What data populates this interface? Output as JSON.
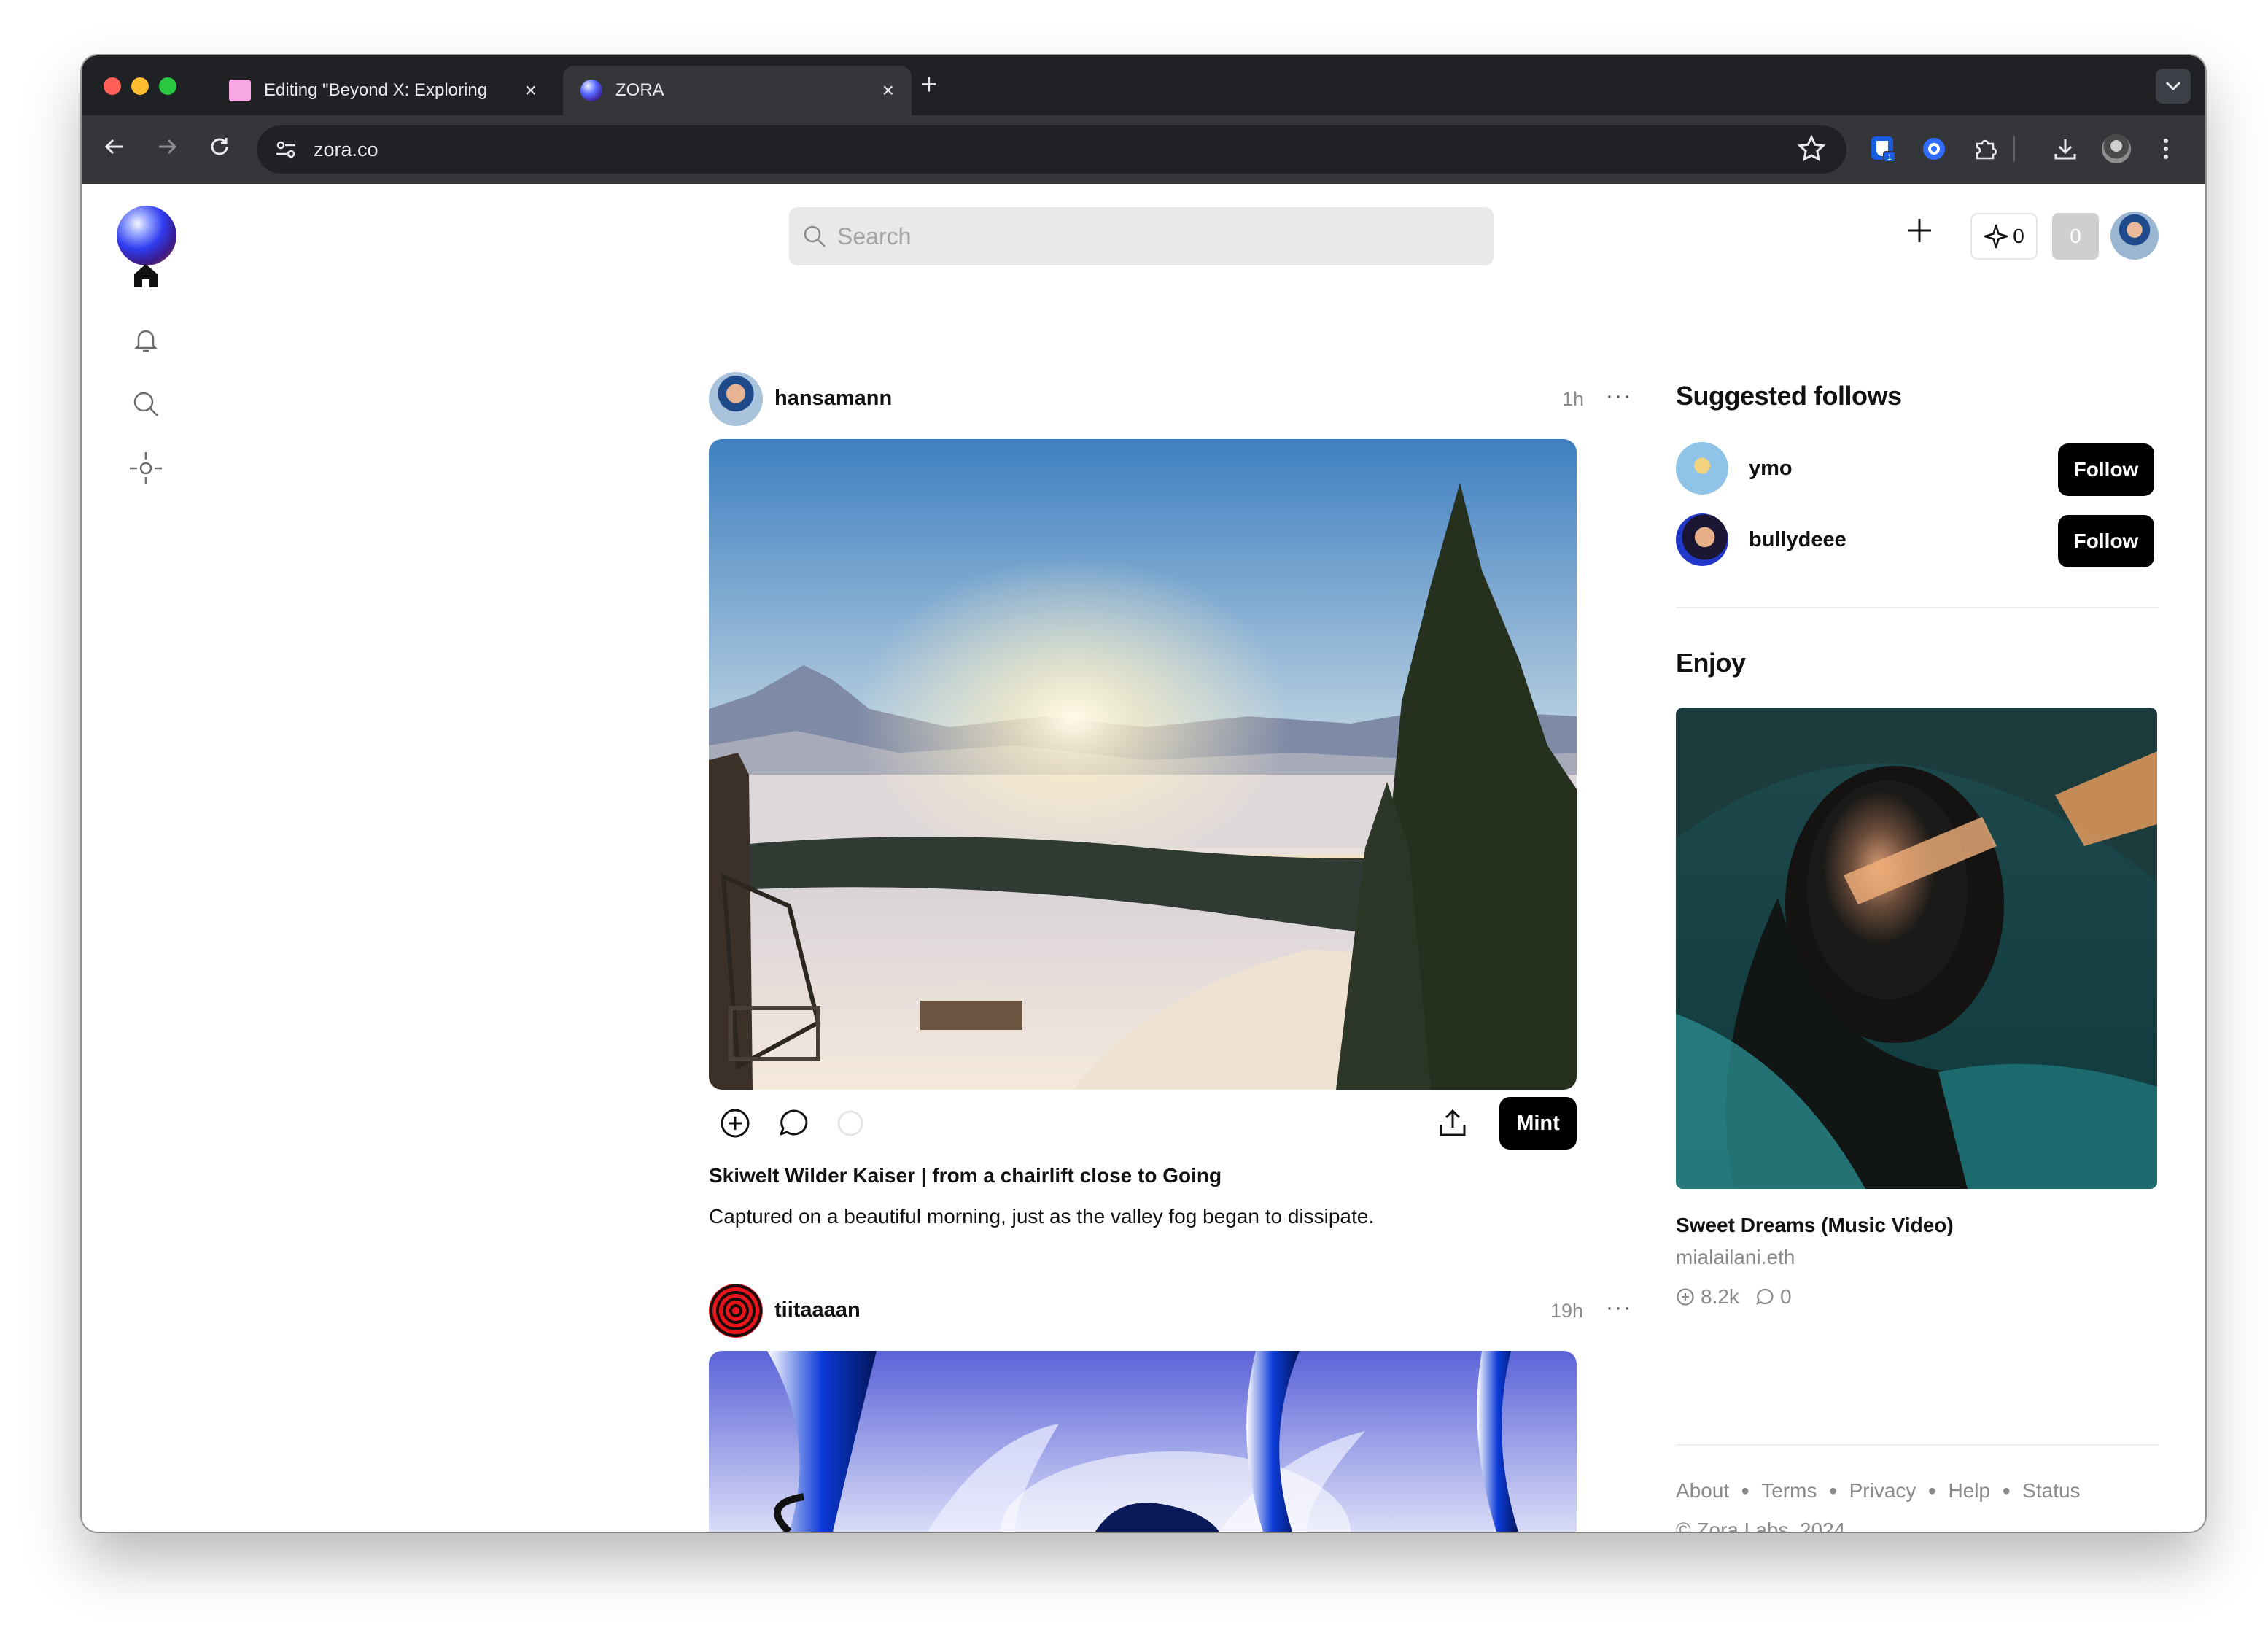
{
  "browser": {
    "tabs": [
      {
        "title": "Editing \"Beyond X: Exploring",
        "close": "×"
      },
      {
        "title": "ZORA",
        "close": "×"
      }
    ],
    "new_tab": "+",
    "url": "zora.co",
    "icons": [
      "back-icon",
      "forward-icon",
      "reload-icon",
      "site-settings-icon",
      "bookmark-star-icon",
      "extensions-icon",
      "downloads-icon",
      "profile-icon",
      "menu-icon"
    ]
  },
  "header": {
    "search_placeholder": "Search",
    "spark_count": "0",
    "balance": "0"
  },
  "feed": {
    "posts": [
      {
        "username": "hansamann",
        "time": "1h",
        "more": "···",
        "title": "Skiwelt Wilder Kaiser | from a chairlift close to Going",
        "description": "Captured on a beautiful morning, just as the valley fog began to dissipate.",
        "mint_label": "Mint"
      },
      {
        "username": "tiitaaaan",
        "time": "19h",
        "more": "···"
      }
    ]
  },
  "sidebar_right": {
    "suggested_title": "Suggested follows",
    "suggested": [
      {
        "name": "ymo",
        "button": "Follow"
      },
      {
        "name": "bullydeee",
        "button": "Follow"
      }
    ],
    "enjoy_title": "Enjoy",
    "enjoy": {
      "title": "Sweet Dreams (Music Video)",
      "creator": "mialailani.eth",
      "mints": "8.2k",
      "comments": "0"
    },
    "footer": {
      "links": [
        "About",
        "Terms",
        "Privacy",
        "Help",
        "Status"
      ],
      "copyright": "© Zora Labs, 2024"
    }
  },
  "colors": {
    "accent": "#000000",
    "tab_strip": "#202124",
    "toolbar": "#35363a",
    "search_bg": "#e9e9e9"
  }
}
